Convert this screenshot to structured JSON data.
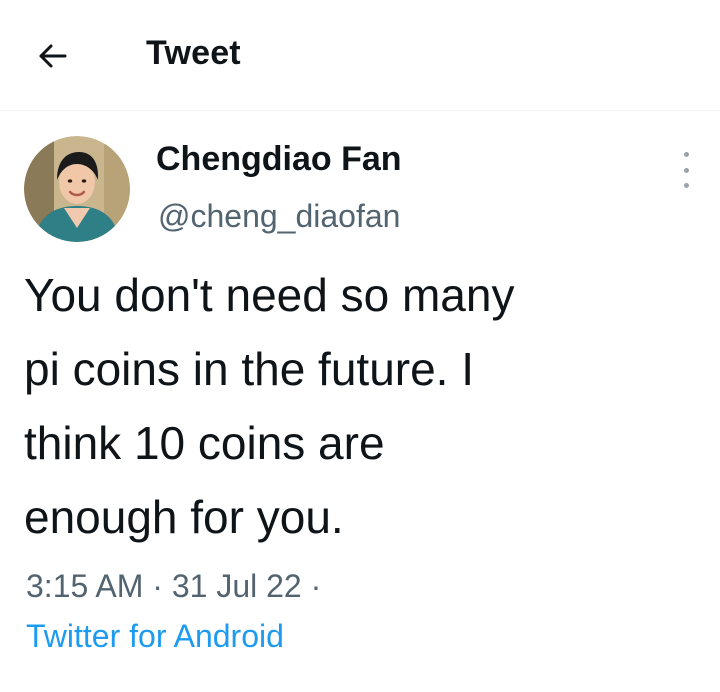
{
  "header": {
    "title": "Tweet",
    "back_icon": "arrow-left-icon"
  },
  "author": {
    "name": "Chengdiao Fan",
    "handle": "@cheng_diaofan",
    "avatar_icon": "user-avatar"
  },
  "tweet": {
    "text": "You don't need so many\npi coins in the future. I\nthink 10 coins are\nenough for you.",
    "time": "3:15 AM",
    "date": "31 Jul 22",
    "separator": "·",
    "source": "Twitter for Android"
  },
  "colors": {
    "text": "#0f1419",
    "secondary": "#536471",
    "link": "#1d9bf0"
  }
}
